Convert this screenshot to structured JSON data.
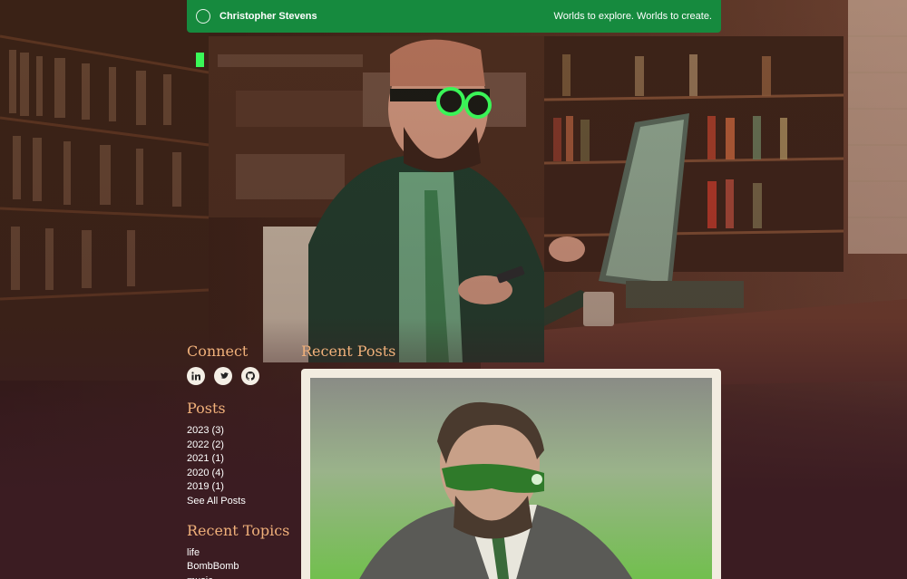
{
  "header": {
    "site_name": "Christopher Stevens",
    "tagline": "Worlds to explore. Worlds to create."
  },
  "sidebar": {
    "connect": {
      "title": "Connect",
      "icons": [
        "linkedin-icon",
        "twitter-icon",
        "github-icon"
      ]
    },
    "posts": {
      "title": "Posts",
      "items": [
        {
          "label": "2023 (3)"
        },
        {
          "label": "2022 (2)"
        },
        {
          "label": "2021 (1)"
        },
        {
          "label": "2020 (4)"
        },
        {
          "label": "2019 (1)"
        },
        {
          "label": "See All Posts"
        }
      ]
    },
    "topics": {
      "title": "Recent Topics",
      "items": [
        {
          "label": "life"
        },
        {
          "label": "BombBomb"
        },
        {
          "label": "music"
        }
      ]
    }
  },
  "main": {
    "recent_posts_title": "Recent Posts"
  },
  "colors": {
    "accent": "#f0b07a",
    "header_green": "#168a3e",
    "background": "#3b1c22",
    "card": "#f2ece0"
  }
}
